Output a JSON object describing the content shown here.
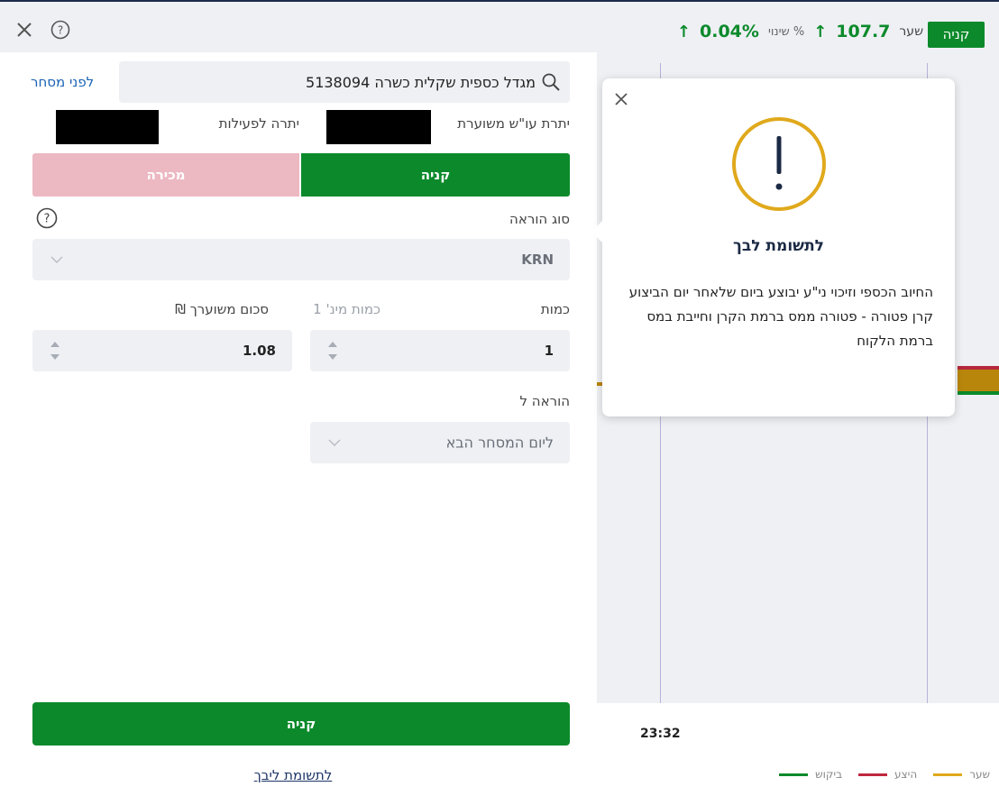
{
  "topbar": {
    "buy_tag": "קניה",
    "rate_label": "שער",
    "rate_value": "107.7",
    "change_label": "% שינוי",
    "change_value": "0.04%",
    "up_arrow": "↑",
    "icons": {
      "close": "close-icon",
      "help": "help-icon",
      "up": "arrow-up-icon"
    }
  },
  "form": {
    "search_value": "מגדל כספית שקלית כשרה 5138094",
    "before_trade_link": "לפני מסחר",
    "balance_label": "יתרת עו\"ש משוערת",
    "available_label": "יתרה לפעילות",
    "buy_tab": "קניה",
    "sell_tab": "מכירה",
    "order_type_label": "סוג הוראה",
    "order_type_value": "KRN",
    "quantity_label": "כמות",
    "min_qty_label": "כמות מינ' 1",
    "estimated_amount_label": "סכום משוערך ₪",
    "quantity_value": "1",
    "estimated_amount_value": "1.08",
    "order_for_label": "הוראה ל",
    "order_for_value": "ליום המסחר הבא",
    "submit_label": "קניה",
    "bottom_link": "לתשומת ליבך"
  },
  "chart": {
    "time_label": "23:32",
    "legend": [
      {
        "label": "שער",
        "color": "#e0a91c"
      },
      {
        "label": "היצע",
        "color": "#c0273f"
      },
      {
        "label": "ביקוש",
        "color": "#0c8a2b"
      }
    ]
  },
  "popover": {
    "title": "לתשומת לבך",
    "line1": "החיוב הכספי וזיכוי ני\"ע יבוצע ביום שלאחר יום הביצוע",
    "line2": "קרן פטורה - פטורה ממס ברמת הקרן וחייבת במס ברמת הלקוח",
    "warning_color": "#e0a91c"
  },
  "colors": {
    "buy_green": "#0c8a2b",
    "sell_pink": "#ecb8c2",
    "link_blue": "#1a63b5"
  }
}
